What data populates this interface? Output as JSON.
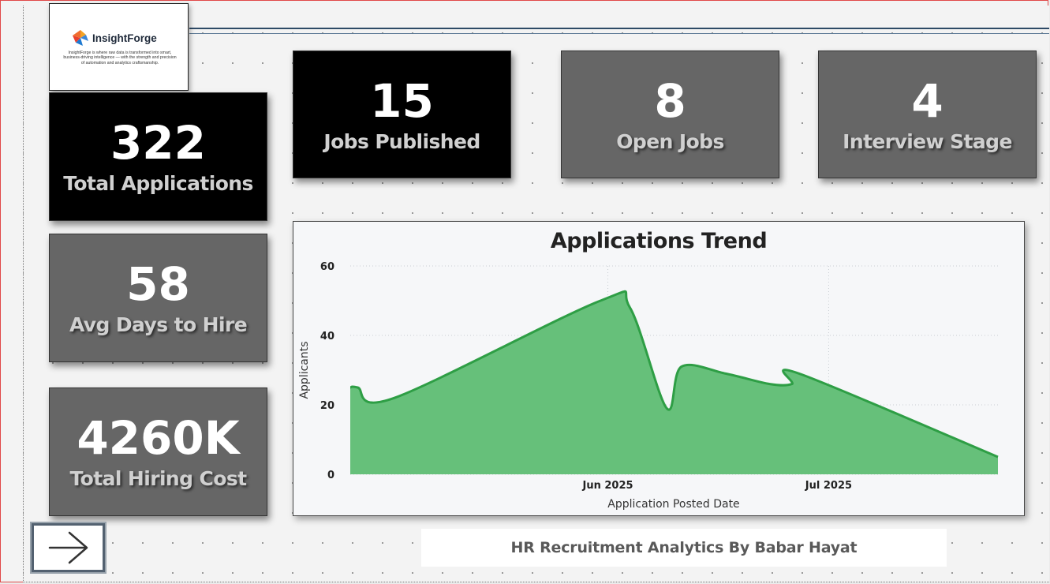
{
  "brand": {
    "name": "InsightForge",
    "tagline": "InsightForge is where raw data is transformed into smart, business-driving intelligence — with the strength and precision of automation and analytics craftsmanship."
  },
  "kpis": {
    "total_applications": {
      "value": "322",
      "label": "Total Applications"
    },
    "jobs_published": {
      "value": "15",
      "label": "Jobs Published"
    },
    "open_jobs": {
      "value": "8",
      "label": "Open Jobs"
    },
    "interview_stage": {
      "value": "4",
      "label": "Interview Stage"
    },
    "avg_days_to_hire": {
      "value": "58",
      "label": "Avg Days to Hire"
    },
    "total_hiring_cost": {
      "value": "4260K",
      "label": "Total Hiring Cost"
    }
  },
  "chart_data": {
    "type": "area",
    "title": "Applications Trend",
    "xlabel": "Application Posted Date",
    "ylabel": "Applicants",
    "ylim": [
      0,
      60
    ],
    "yticks": [
      0,
      20,
      40,
      60
    ],
    "xticks": [
      {
        "date": "2025-06-01",
        "label": "Jun 2025"
      },
      {
        "date": "2025-07-01",
        "label": "Jul 2025"
      }
    ],
    "x": [
      "2025-04-27",
      "2025-04-28",
      "2025-05-03",
      "2025-05-31",
      "2025-06-04",
      "2025-06-09",
      "2025-06-11",
      "2025-06-17",
      "2025-06-23",
      "2025-06-26",
      "2025-06-27",
      "2025-07-24"
    ],
    "values": [
      25,
      25,
      22,
      50,
      48,
      19,
      31,
      29,
      26,
      26,
      29,
      5
    ],
    "series_color": "#2e9e45",
    "fill_color": "#66c07a",
    "grid": true
  },
  "footer": {
    "text": "HR Recruitment Analytics By Babar Hayat"
  },
  "nav": {
    "icon": "arrow-right-icon"
  },
  "colors": {
    "kpi_dark": "#000000",
    "kpi_gray": "#666666",
    "accent_line": "#2e4a66"
  }
}
